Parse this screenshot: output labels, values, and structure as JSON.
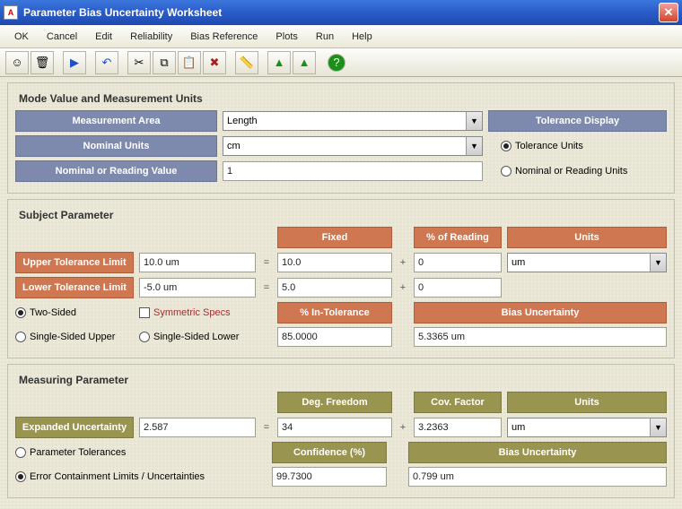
{
  "title": "Parameter Bias Uncertainty Worksheet",
  "menu": [
    "OK",
    "Cancel",
    "Edit",
    "Reliability",
    "Bias Reference",
    "Plots",
    "Run",
    "Help"
  ],
  "toolbar_icons": [
    "smiley",
    "trash",
    "play",
    "undo",
    "cut",
    "copy",
    "paste",
    "delete",
    "ruler",
    "triangle-up",
    "triangle-up2",
    "help"
  ],
  "section1": {
    "title": "Mode Value and Measurement Units",
    "measurement_area_label": "Measurement Area",
    "measurement_area_value": "Length",
    "nominal_units_label": "Nominal Units",
    "nominal_units_value": "cm",
    "nominal_value_label": "Nominal or Reading Value",
    "nominal_value_value": "1",
    "tolerance_display_label": "Tolerance Display",
    "radio_tol_units": "Tolerance Units",
    "radio_nom_units": "Nominal or Reading Units"
  },
  "section2": {
    "title": "Subject Parameter",
    "fixed_label": "Fixed",
    "pct_reading_label": "% of Reading",
    "units_label": "Units",
    "upper_tol_label": "Upper Tolerance Limit",
    "upper_tol_value": "10.0 um",
    "upper_fixed": "10.0",
    "upper_pct": "0",
    "lower_tol_label": "Lower Tolerance Limit",
    "lower_tol_value": "-5.0 um",
    "lower_fixed": "5.0",
    "lower_pct": "0",
    "units_value": "um",
    "radio_two_sided": "Two-Sided",
    "radio_ss_upper": "Single-Sided Upper",
    "chk_symmetric": "Symmetric Specs",
    "radio_ss_lower": "Single-Sided Lower",
    "pct_intol_label": "% In-Tolerance",
    "pct_intol_value": "85.0000",
    "bias_unc_label": "Bias Uncertainty",
    "bias_unc_value": "5.3365 um"
  },
  "section3": {
    "title": "Measuring Parameter",
    "deg_freedom_label": "Deg. Freedom",
    "cov_factor_label": "Cov. Factor",
    "units_label": "Units",
    "exp_unc_label": "Expanded Uncertainty",
    "exp_unc_value": "2.587",
    "deg_freedom_value": "34",
    "cov_factor_value": "3.2363",
    "units_value": "um",
    "radio_param_tol": "Parameter Tolerances",
    "radio_err_cont": "Error Containment Limits / Uncertainties",
    "confidence_label": "Confidence (%)",
    "confidence_value": "99.7300",
    "bias_unc_label": "Bias Uncertainty",
    "bias_unc_value": "0.799 um"
  }
}
